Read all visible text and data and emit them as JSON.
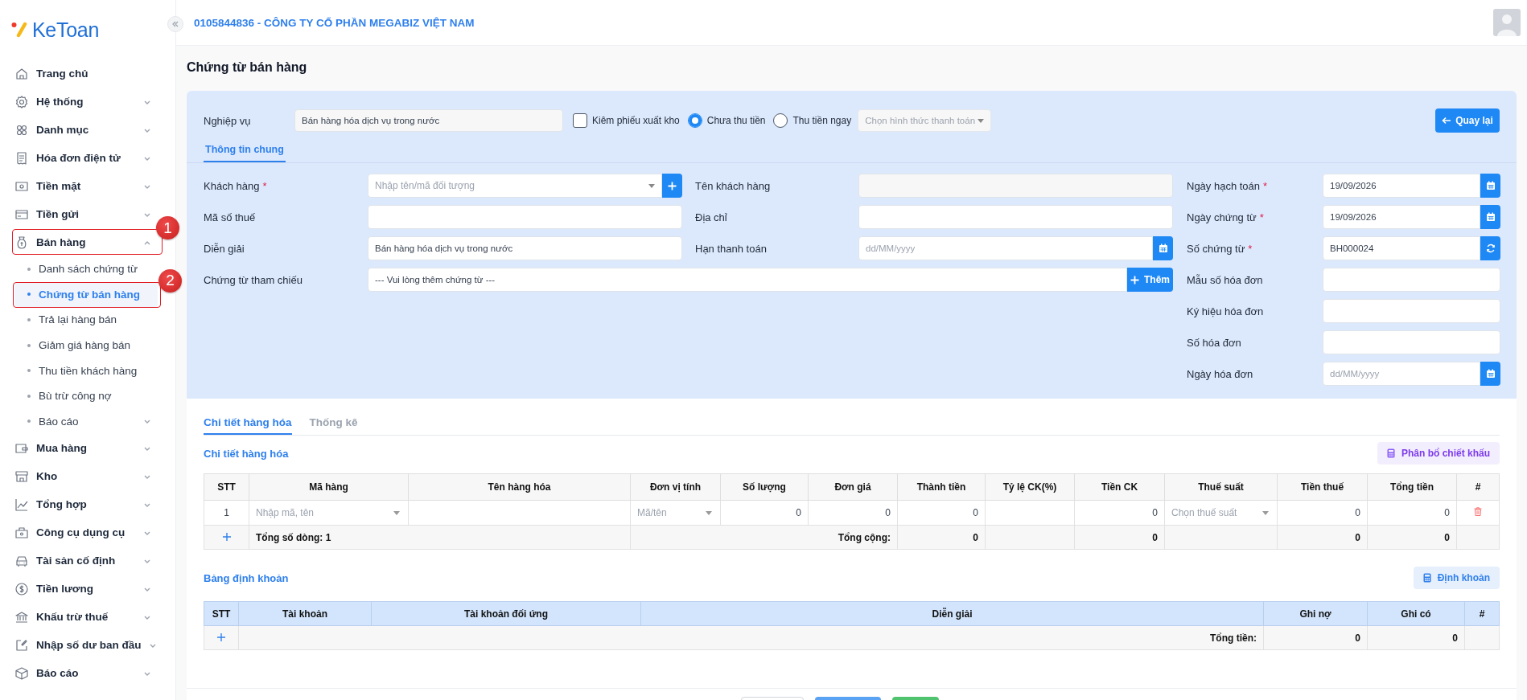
{
  "logo": {
    "text": "KeToan"
  },
  "sidebar": {
    "items": [
      {
        "label": "Trang chủ"
      },
      {
        "label": "Hệ thống",
        "expanded": false
      },
      {
        "label": "Danh mục",
        "expanded": false
      },
      {
        "label": "Hóa đơn điện tử",
        "expanded": false
      },
      {
        "label": "Tiền mặt",
        "expanded": false
      },
      {
        "label": "Tiền gửi",
        "expanded": false
      },
      {
        "label": "Bán hàng",
        "expanded": true,
        "callout": "1",
        "children": [
          {
            "label": "Danh sách chứng từ",
            "selected": false
          },
          {
            "label": "Chứng từ bán hàng",
            "selected": true,
            "callout": "2"
          },
          {
            "label": "Trả lại hàng bán",
            "selected": false
          },
          {
            "label": "Giảm giá hàng bán",
            "selected": false
          },
          {
            "label": "Thu tiền khách hàng",
            "selected": false
          },
          {
            "label": "Bù trừ công nợ",
            "selected": false
          },
          {
            "label": "Báo cáo",
            "selected": false,
            "expanded": false
          }
        ]
      },
      {
        "label": "Mua hàng",
        "expanded": false
      },
      {
        "label": "Kho",
        "expanded": false
      },
      {
        "label": "Tổng hợp",
        "expanded": false
      },
      {
        "label": "Công cụ dụng cụ",
        "expanded": false
      },
      {
        "label": "Tài sản cố định",
        "expanded": false
      },
      {
        "label": "Tiền lương",
        "expanded": false
      },
      {
        "label": "Khấu trừ thuế",
        "expanded": false
      },
      {
        "label": "Nhập số dư ban đầu",
        "expanded": false
      },
      {
        "label": "Báo cáo",
        "expanded": false
      }
    ]
  },
  "header": {
    "company": "0105844836 - CÔNG TY CỔ PHẦN MEGABIZ VIỆT NAM"
  },
  "page_title": "Chứng từ bán hàng",
  "business": {
    "label": "Nghiệp vụ",
    "value": "Bán hàng hóa dịch vụ trong nước"
  },
  "options": [
    {
      "kind": "checkbox",
      "label": "Kiêm phiếu xuất kho",
      "checked": false
    },
    {
      "kind": "radio",
      "label": "Chưa thu tiền",
      "selected": true
    },
    {
      "kind": "radio",
      "label": "Thu tiền ngay",
      "selected": false
    }
  ],
  "payment_select": {
    "placeholder": "Chọn hình thức thanh toán"
  },
  "back_button": "Quay lại",
  "form_tabs": [
    {
      "label": "Thông tin chung",
      "selected": true
    }
  ],
  "left_fields": [
    {
      "kind": "select_add",
      "label": "Khách hàng",
      "required_mark": "*",
      "placeholder": "Nhập tên/mã đối tượng"
    },
    {
      "kind": "text",
      "label": "Mã số thuế"
    },
    {
      "kind": "text",
      "label": "Diễn giải",
      "value": "Bán hàng hóa dịch vụ trong nước"
    }
  ],
  "middle_fields": [
    {
      "kind": "readonly",
      "label": "Tên khách hàng"
    },
    {
      "kind": "text",
      "label": "Địa chỉ"
    },
    {
      "kind": "date",
      "label": "Hạn thanh toán",
      "placeholder": "dd/MM/yyyy"
    }
  ],
  "reference_field": {
    "label": "Chứng từ tham chiếu",
    "value": "--- Vui lòng thêm chứng từ ---",
    "button": "Thêm"
  },
  "right_fields": [
    {
      "kind": "date",
      "label": "Ngày hạch toán",
      "required_mark": "*",
      "value": "19/09/2026"
    },
    {
      "kind": "date",
      "label": "Ngày chứng từ",
      "required_mark": "*",
      "value": "19/09/2026"
    },
    {
      "kind": "refresh",
      "label": "Số chứng từ",
      "required_mark": "*",
      "value": "BH000024"
    },
    {
      "kind": "text",
      "label": "Mẫu số hóa đơn"
    },
    {
      "kind": "text",
      "label": "Ký hiệu hóa đơn"
    },
    {
      "kind": "text",
      "label": "Số hóa đơn"
    },
    {
      "kind": "date",
      "label": "Ngày hóa đơn",
      "placeholder": "dd/MM/yyyy"
    }
  ],
  "detail_tabs": [
    {
      "label": "Chi tiết hàng hóa",
      "selected": true
    },
    {
      "label": "Thống kê",
      "selected": false
    }
  ],
  "goods": {
    "title": "Chi tiết hàng hóa",
    "button": "Phân bổ chiết khấu",
    "columns": [
      "STT",
      "Mã hàng",
      "Tên hàng hóa",
      "Đơn vị tính",
      "Số lượng",
      "Đơn giá",
      "Thành tiền",
      "Tỷ lệ CK(%)",
      "Tiền CK",
      "Thuế suất",
      "Tiền thuế",
      "Tổng tiền",
      "#"
    ],
    "rows": [
      {
        "cells": [
          {
            "kind": "index",
            "value": "1"
          },
          {
            "kind": "select",
            "placeholder": "Nhập mã, tên"
          },
          {
            "kind": "input"
          },
          {
            "kind": "select",
            "placeholder": "Mã/tên"
          },
          {
            "kind": "number",
            "value": "0"
          },
          {
            "kind": "number",
            "value": "0"
          },
          {
            "kind": "number",
            "value": "0"
          },
          {
            "kind": "input"
          },
          {
            "kind": "number",
            "value": "0"
          },
          {
            "kind": "select",
            "placeholder": "Chọn thuế suất"
          },
          {
            "kind": "number",
            "value": "0"
          },
          {
            "kind": "number",
            "value": "0"
          },
          {
            "kind": "delete"
          }
        ]
      }
    ],
    "totals": {
      "row_count": "Tổng số dòng: 1",
      "label": "Tổng cộng:",
      "amount": "0",
      "discount": "0",
      "tax": "0",
      "total": "0"
    }
  },
  "entries": {
    "title": "Bảng định khoản",
    "button": "Định khoản",
    "columns": [
      "STT",
      "Tài khoản",
      "Tài khoản đối ứng",
      "Diễn giải",
      "Ghi nợ",
      "Ghi có",
      "#"
    ],
    "totals": {
      "label": "Tổng tiền:",
      "debit": "0",
      "credit": "0"
    }
  }
}
